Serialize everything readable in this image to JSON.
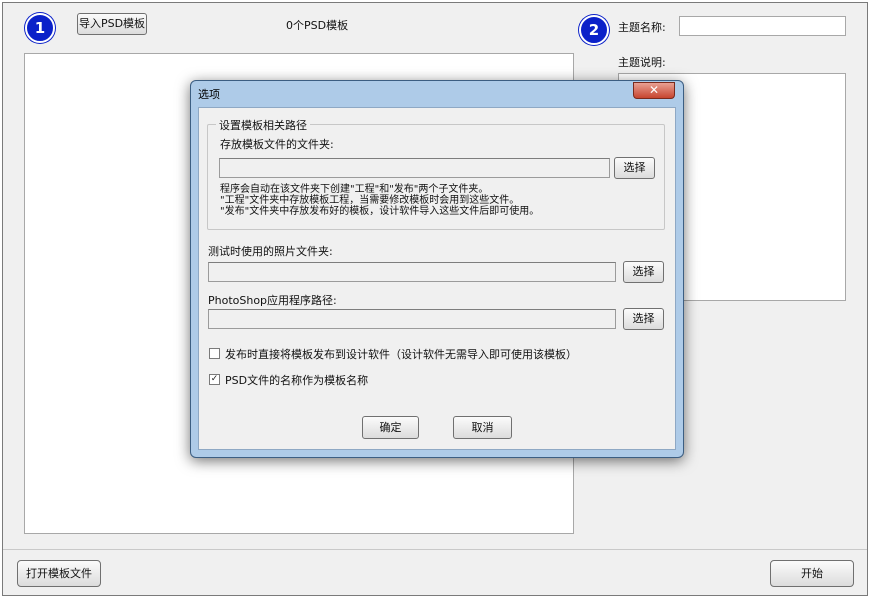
{
  "main": {
    "step1_badge": "1",
    "import_button": "导入PSD模板",
    "template_count": "0个PSD模板",
    "step2_badge": "2",
    "theme_name_label": "主题名称:",
    "theme_name_value": "",
    "theme_desc_label": "主题说明:",
    "open_file_button": "打开模板文件",
    "start_button": "开始"
  },
  "dialog": {
    "title": "选项",
    "close_glyph": "✕",
    "group_title": "设置模板相关路径",
    "template_folder_label": "存放模板文件的文件夹:",
    "template_folder_value": "",
    "browse_label": "选择",
    "info_lines": [
      "程序会自动在该文件夹下创建\"工程\"和\"发布\"两个子文件夹。",
      "\"工程\"文件夹中存放模板工程，当需要修改模板时会用到这些文件。",
      "\"发布\"文件夹中存放发布好的模板，设计软件导入这些文件后即可使用。"
    ],
    "test_photo_label": "测试时使用的照片文件夹:",
    "test_photo_value": "",
    "photoshop_label": "PhotoShop应用程序路径:",
    "photoshop_value": "",
    "option_publish": {
      "label": "发布时直接将模板发布到设计软件（设计软件无需导入即可使用该模板）",
      "checked": false,
      "mark": ""
    },
    "option_psd_name": {
      "label": "PSD文件的名称作为模板名称",
      "checked": true,
      "mark": "✓"
    },
    "ok_button": "确定",
    "cancel_button": "取消"
  }
}
